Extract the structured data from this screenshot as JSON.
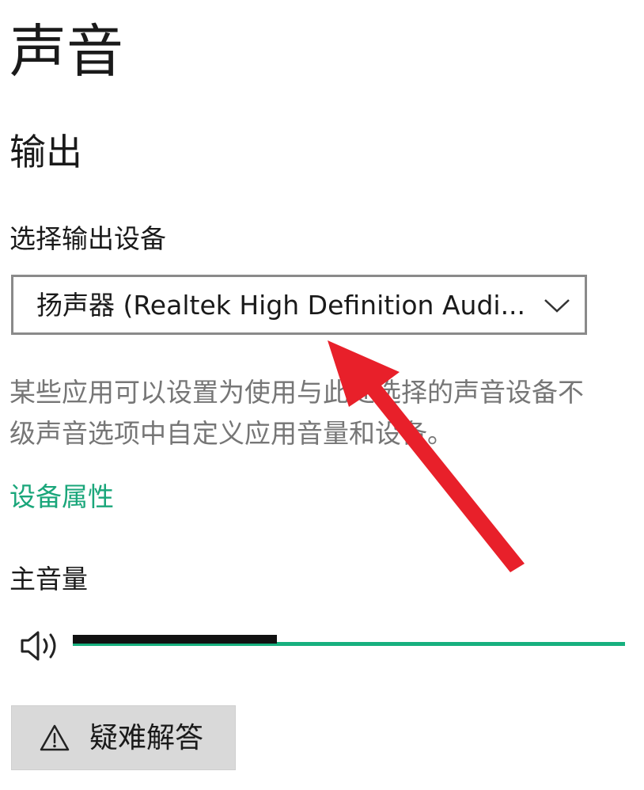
{
  "page": {
    "title": "声音"
  },
  "output": {
    "section_title": "输出",
    "device_label": "选择输出设备",
    "selected_device": "扬声器 (Realtek High Definition Audi...",
    "description_lines": [
      "某些应用可以设置为使用与此处选择的声音设备不",
      "级声音选项中自定义应用音量和设备。"
    ],
    "device_properties_link": "设备属性",
    "master_volume_label": "主音量",
    "master_volume_fraction": 0.37
  },
  "troubleshoot": {
    "label": "疑难解答"
  },
  "icons": {
    "speaker": "speaker-volume-icon",
    "dropdown": "chevron-down-icon",
    "warning": "warning-icon"
  },
  "colors": {
    "accent": "#17b07e",
    "link": "#1aa67a",
    "annotation_arrow": "#e8202a"
  }
}
